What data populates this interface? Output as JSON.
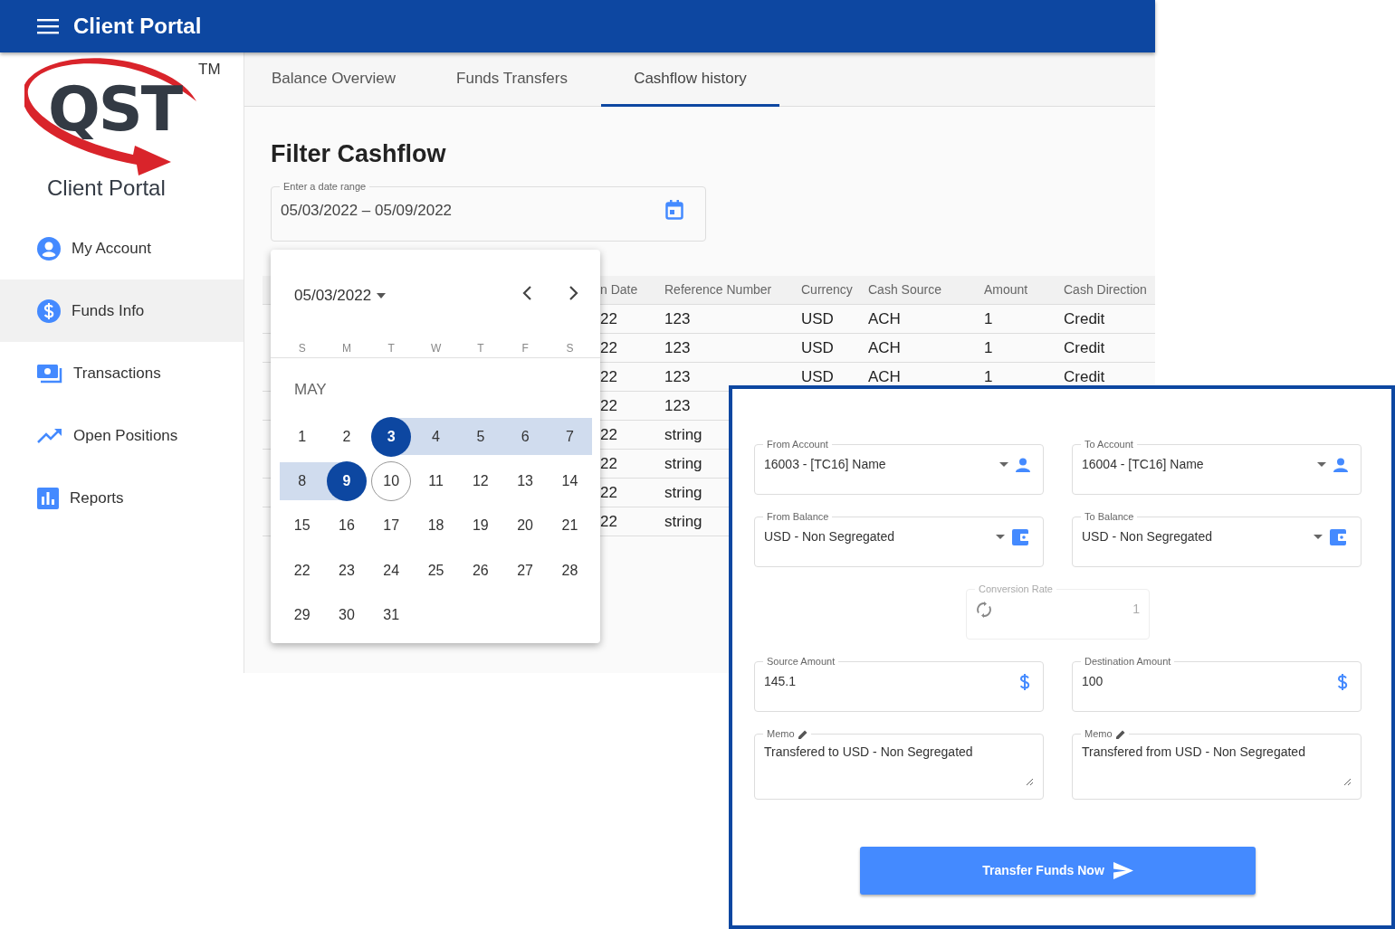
{
  "app_bar": {
    "title": "Client Portal"
  },
  "logo": {
    "letters": "QST",
    "trademark": "TM",
    "caption": "Client Portal"
  },
  "sidebar": {
    "items": [
      {
        "label": "My Account",
        "selected": false
      },
      {
        "label": "Funds Info",
        "selected": true
      },
      {
        "label": "Transactions",
        "selected": false
      },
      {
        "label": "Open Positions",
        "selected": false
      },
      {
        "label": "Reports",
        "selected": false
      }
    ]
  },
  "tabs": [
    {
      "label": "Balance Overview",
      "selected": false
    },
    {
      "label": "Funds Transfers",
      "selected": false
    },
    {
      "label": "Cashflow history",
      "selected": true
    }
  ],
  "filter": {
    "title": "Filter Cashflow",
    "date_range": {
      "label": "Enter a date range",
      "value": "05/03/2022 – 05/09/2022"
    }
  },
  "table": {
    "columns": [
      "n Date",
      "Reference Number",
      "Currency",
      "Cash Source",
      "Amount",
      "Cash Direction"
    ],
    "rows": [
      [
        "22",
        "123",
        "USD",
        "ACH",
        "1",
        "Credit"
      ],
      [
        "22",
        "123",
        "USD",
        "ACH",
        "1",
        "Credit"
      ],
      [
        "22",
        "123",
        "USD",
        "ACH",
        "1",
        "Credit"
      ],
      [
        "22",
        "123"
      ],
      [
        "22",
        "string"
      ],
      [
        "22",
        "string"
      ],
      [
        "22",
        "string"
      ],
      [
        "22",
        "string"
      ]
    ]
  },
  "calendar": {
    "period": "05/03/2022",
    "weekdays": [
      "S",
      "M",
      "T",
      "W",
      "T",
      "F",
      "S"
    ],
    "month": "MAY",
    "days": [
      {
        "label": "1",
        "selected": false,
        "in_range": false,
        "today": false
      },
      {
        "label": "2",
        "selected": false,
        "in_range": false,
        "today": false
      },
      {
        "label": "3",
        "selected": true,
        "in_range": true,
        "today": false
      },
      {
        "label": "4",
        "selected": false,
        "in_range": true,
        "today": false
      },
      {
        "label": "5",
        "selected": false,
        "in_range": true,
        "today": false
      },
      {
        "label": "6",
        "selected": false,
        "in_range": true,
        "today": false
      },
      {
        "label": "7",
        "selected": false,
        "in_range": true,
        "today": false
      },
      {
        "label": "8",
        "selected": false,
        "in_range": true,
        "today": false
      },
      {
        "label": "9",
        "selected": true,
        "in_range": true,
        "today": false
      },
      {
        "label": "10",
        "selected": false,
        "in_range": false,
        "today": true
      },
      {
        "label": "11",
        "selected": false,
        "in_range": false,
        "today": false
      },
      {
        "label": "12",
        "selected": false,
        "in_range": false,
        "today": false
      },
      {
        "label": "13",
        "selected": false,
        "in_range": false,
        "today": false
      },
      {
        "label": "14",
        "selected": false,
        "in_range": false,
        "today": false
      },
      {
        "label": "15",
        "selected": false,
        "in_range": false,
        "today": false
      },
      {
        "label": "16",
        "selected": false,
        "in_range": false,
        "today": false
      },
      {
        "label": "17",
        "selected": false,
        "in_range": false,
        "today": false
      },
      {
        "label": "18",
        "selected": false,
        "in_range": false,
        "today": false
      },
      {
        "label": "19",
        "selected": false,
        "in_range": false,
        "today": false
      },
      {
        "label": "20",
        "selected": false,
        "in_range": false,
        "today": false
      },
      {
        "label": "21",
        "selected": false,
        "in_range": false,
        "today": false
      },
      {
        "label": "22",
        "selected": false,
        "in_range": false,
        "today": false
      },
      {
        "label": "23",
        "selected": false,
        "in_range": false,
        "today": false
      },
      {
        "label": "24",
        "selected": false,
        "in_range": false,
        "today": false
      },
      {
        "label": "25",
        "selected": false,
        "in_range": false,
        "today": false
      },
      {
        "label": "26",
        "selected": false,
        "in_range": false,
        "today": false
      },
      {
        "label": "27",
        "selected": false,
        "in_range": false,
        "today": false
      },
      {
        "label": "28",
        "selected": false,
        "in_range": false,
        "today": false
      },
      {
        "label": "29",
        "selected": false,
        "in_range": false,
        "today": false
      },
      {
        "label": "30",
        "selected": false,
        "in_range": false,
        "today": false
      },
      {
        "label": "31",
        "selected": false,
        "in_range": false,
        "today": false
      }
    ]
  },
  "transfer_form": {
    "rows": [
      [
        {
          "kind": "account",
          "label": "From Account",
          "value": "16003 - [TC16]  Name",
          "disabled": false
        },
        {
          "kind": "account",
          "label": "To Account",
          "value": "16004 - [TC16]  Name",
          "disabled": false
        }
      ],
      [
        {
          "kind": "balance",
          "label": "From Balance",
          "value": "USD - Non Segregated",
          "disabled": false
        },
        {
          "kind": "balance",
          "label": "To Balance",
          "value": "USD - Non Segregated",
          "disabled": false
        }
      ],
      [
        {
          "kind": "rate",
          "label": "Conversion Rate",
          "value": "1",
          "disabled": true
        }
      ],
      [
        {
          "kind": "amount",
          "label": "Source Amount",
          "value": "145.1",
          "disabled": false
        },
        {
          "kind": "amount",
          "label": "Destination Amount",
          "value": "100",
          "disabled": false
        }
      ],
      [
        {
          "kind": "memo",
          "label": "Memo",
          "value": "Transfered to USD - Non Segregated",
          "disabled": false
        },
        {
          "kind": "memo",
          "label": "Memo",
          "value": "Transfered from USD - Non Segregated",
          "disabled": false
        }
      ]
    ],
    "button": {
      "label": "Transfer Funds Now"
    }
  }
}
